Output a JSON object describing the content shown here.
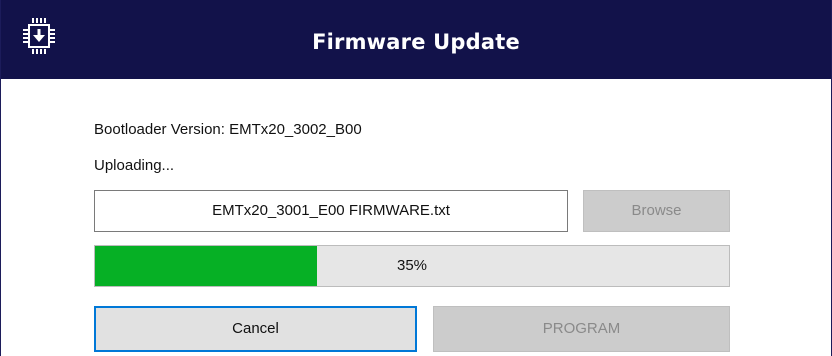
{
  "window": {
    "title": "Firmware Update",
    "app_icon": "chip-download-icon"
  },
  "info": {
    "bootloader_version": "Bootloader Version: EMTx20_3002_B00",
    "status": "Uploading..."
  },
  "file": {
    "value": "EMTx20_3001_E00 FIRMWARE.txt"
  },
  "buttons": {
    "browse": "Browse",
    "cancel": "Cancel",
    "program": "PROGRAM"
  },
  "progress": {
    "percent": 35,
    "label": "35%"
  },
  "colors": {
    "titlebar": "#12124a",
    "progress_fill": "#06b025",
    "focus_border": "#0078d7",
    "disabled_bg": "#cccccc"
  }
}
